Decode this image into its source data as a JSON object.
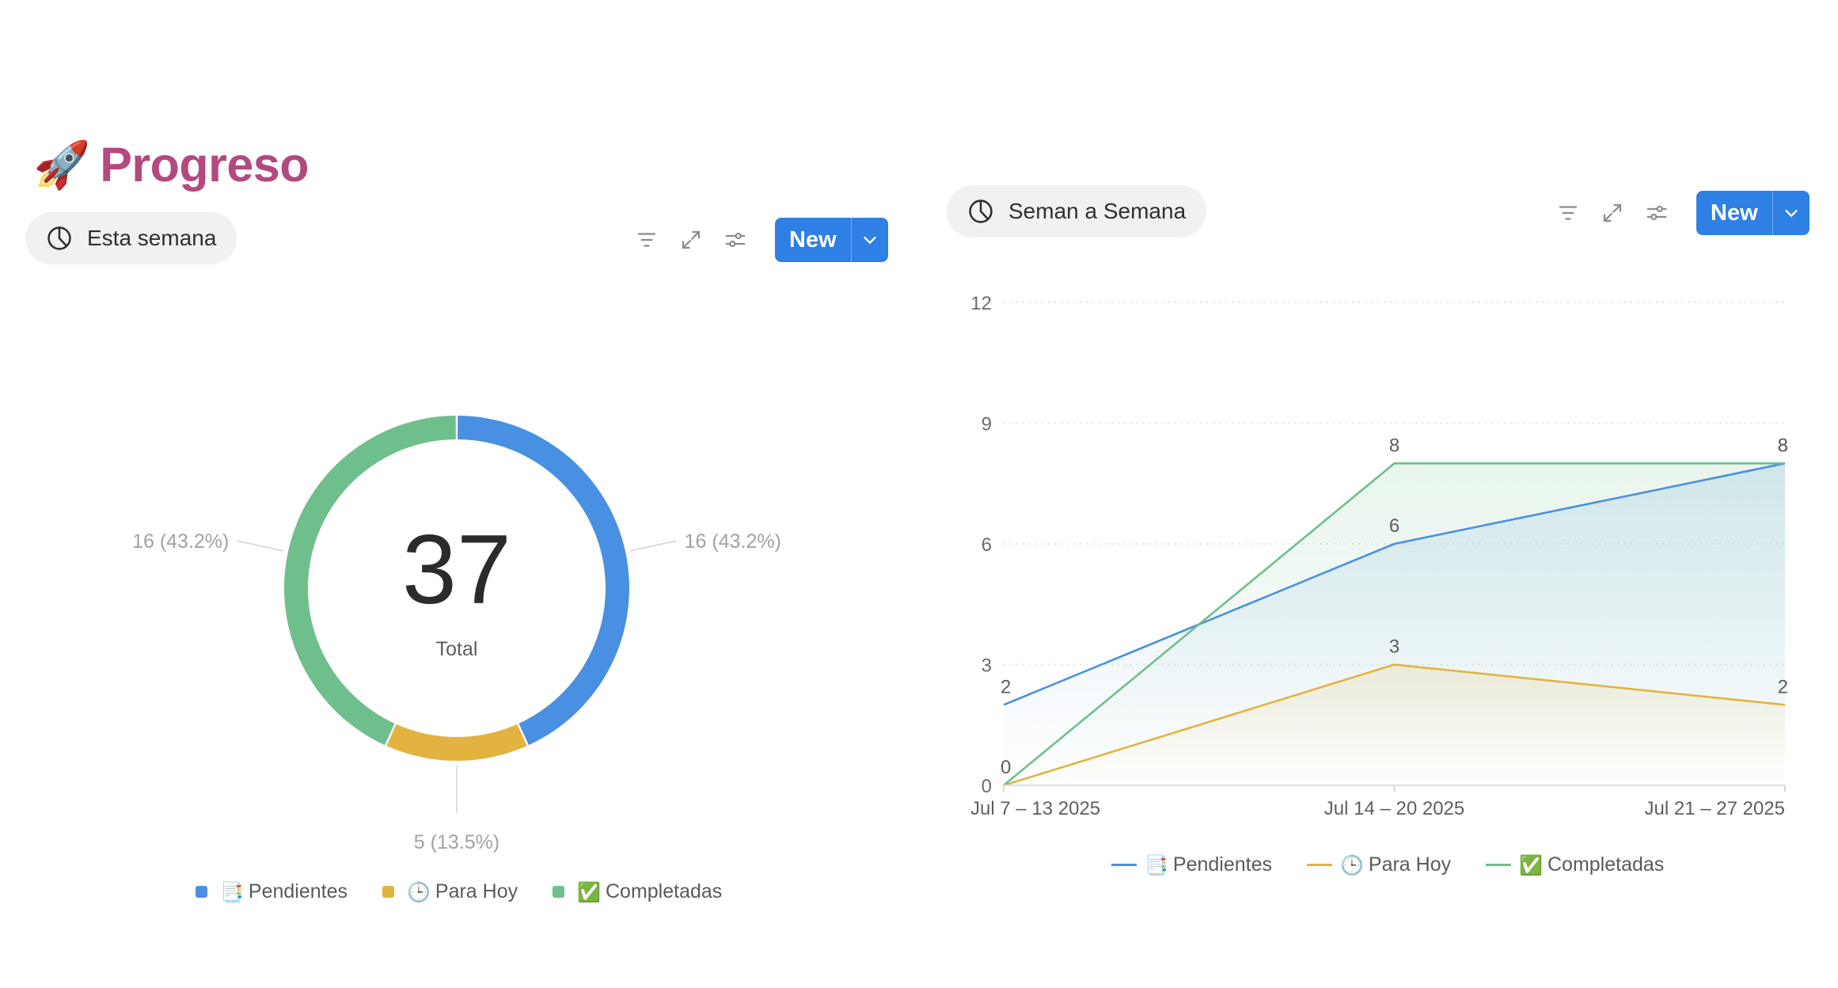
{
  "page": {
    "title_emoji": "🚀",
    "title": "Progreso",
    "title_color": "#b3497e"
  },
  "left_view": {
    "tab_label": "Esta semana",
    "tab_icon": "pie-chart-icon",
    "new_label": "New",
    "toolbar_icons": [
      "filter-icon",
      "expand-icon",
      "settings-sliders-icon",
      "chevron-down-icon"
    ]
  },
  "right_view": {
    "tab_label": "Seman a Semana",
    "tab_icon": "pie-chart-icon",
    "new_label": "New",
    "toolbar_icons": [
      "filter-icon",
      "expand-icon",
      "settings-sliders-icon",
      "chevron-down-icon"
    ]
  },
  "legend": [
    {
      "emoji": "📑",
      "label": "Pendientes",
      "color": "#4a90e2"
    },
    {
      "emoji": "🕒",
      "label": "Para Hoy",
      "color": "#e3b341"
    },
    {
      "emoji": "✅",
      "label": "Completadas",
      "color": "#6fbf8c"
    }
  ],
  "chart_data": [
    {
      "type": "pie",
      "donut": true,
      "center_value": "37",
      "center_label": "Total",
      "slices": [
        {
          "name": "📑 Pendientes",
          "value": 16,
          "label": "16 (43.2%)",
          "color": "#4a90e2"
        },
        {
          "name": "🕒 Para Hoy",
          "value": 5,
          "label": "5 (13.5%)",
          "color": "#e3b341"
        },
        {
          "name": "✅ Completadas",
          "value": 16,
          "label": "16 (43.2%)",
          "color": "#6fbf8c"
        }
      ],
      "legend_position": "bottom"
    },
    {
      "type": "line",
      "categories": [
        "Jul 7 – 13 2025",
        "Jul 14 – 20 2025",
        "Jul 21 – 27 2025"
      ],
      "series": [
        {
          "name": "📑 Pendientes",
          "values": [
            2,
            6,
            8
          ],
          "color": "#4a90e2"
        },
        {
          "name": "🕒 Para Hoy",
          "values": [
            0,
            3,
            2
          ],
          "color": "#e3b341"
        },
        {
          "name": "✅ Completadas",
          "values": [
            0,
            8,
            8
          ],
          "color": "#6fbf8c"
        }
      ],
      "yticks": [
        0,
        3,
        6,
        9,
        12
      ],
      "ylim": [
        0,
        12
      ],
      "grid": true,
      "data_labels": true,
      "legend_position": "bottom"
    }
  ]
}
